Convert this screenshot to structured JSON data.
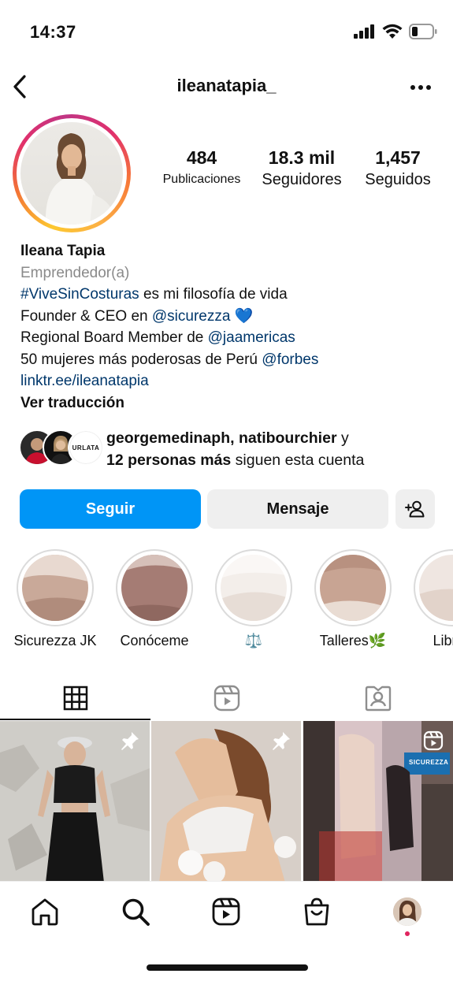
{
  "status_bar": {
    "time": "14:37",
    "icons": [
      "signal-icon",
      "wifi-icon",
      "battery-icon"
    ]
  },
  "header": {
    "back_icon": "chevron-left-icon",
    "username": "ileanatapia_",
    "more_icon": "more-horizontal-icon"
  },
  "profile": {
    "stats": [
      {
        "value": "484",
        "label": "Publicaciones"
      },
      {
        "value": "18.3 mil",
        "label": "Seguidores"
      },
      {
        "value": "1,457",
        "label": "Seguidos"
      }
    ],
    "name": "Ileana Tapia",
    "category": "Emprendedor(a)",
    "bio": {
      "line1_tag": "#ViveSinCosturas",
      "line1_text": " es mi filosofía de vida",
      "line2_text": "Founder & CEO en ",
      "line2_mention": "@sicurezza",
      "line2_emoji": "💙",
      "line3_text": "Regional Board Member de ",
      "line3_mention": "@jaamericas",
      "line4_text": "50 mujeres más poderosas de Perú ",
      "line4_mention": "@forbes",
      "link": "linktr.ee/ileanatapia"
    },
    "translate": "Ver traducción"
  },
  "followed_by": {
    "names": "georgemedinaph, natibourchier",
    "conj": " y",
    "more": "12 personas más",
    "suffix": " siguen esta cuenta",
    "avatar3_text": "URLATA"
  },
  "actions": {
    "follow": "Seguir",
    "message": "Mensaje",
    "add_icon": "add-person-icon"
  },
  "highlights": [
    {
      "label": "Sicurezza JK"
    },
    {
      "label": "Conóceme"
    },
    {
      "label": "⚖️"
    },
    {
      "label": "Talleres🌿"
    },
    {
      "label": "Libros"
    }
  ],
  "tabs": [
    {
      "icon": "grid-icon",
      "active": true
    },
    {
      "icon": "reels-icon",
      "active": false
    },
    {
      "icon": "tagged-icon",
      "active": false
    }
  ],
  "posts": [
    {
      "badge": "pin-icon"
    },
    {
      "badge": "pin-icon"
    },
    {
      "badge": "reel-icon",
      "sign_text": "SICUREZZA"
    }
  ],
  "bottom_nav": [
    {
      "icon": "home-icon"
    },
    {
      "icon": "search-icon"
    },
    {
      "icon": "reels-icon"
    },
    {
      "icon": "shop-icon"
    },
    {
      "icon": "profile-avatar"
    }
  ],
  "colors": {
    "accent": "#0095f6",
    "link": "#00376b",
    "secondary_text": "#8a8a8a",
    "button_gray": "#efefef",
    "notification_dot": "#e0245e"
  }
}
